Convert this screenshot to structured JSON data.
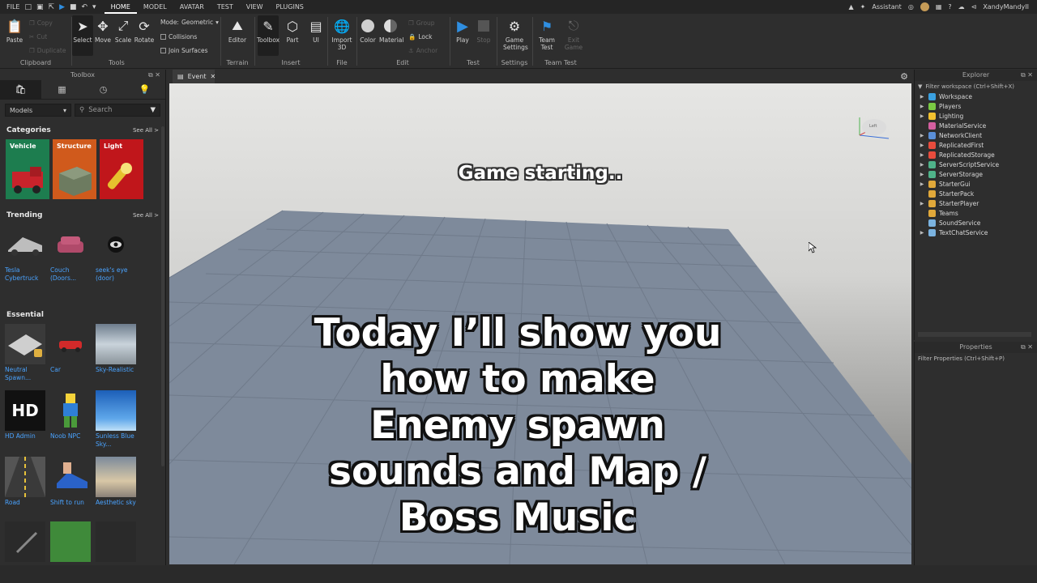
{
  "menubar": {
    "file": "FILE",
    "tabs": [
      "HOME",
      "MODEL",
      "AVATAR",
      "TEST",
      "VIEW",
      "PLUGINS"
    ],
    "active_tab": "HOME",
    "assistant": "Assistant",
    "username": "XandyMandyII"
  },
  "ribbon": {
    "clipboard": {
      "label": "Clipboard",
      "paste": "Paste",
      "copy": "Copy",
      "cut": "Cut",
      "duplicate": "Duplicate"
    },
    "tools": {
      "label": "Tools",
      "select": "Select",
      "move": "Move",
      "scale": "Scale",
      "rotate": "Rotate",
      "mode_label": "Mode:",
      "mode_value": "Geometric",
      "collisions": "Collisions",
      "join_surfaces": "Join Surfaces"
    },
    "terrain": {
      "label": "Terrain",
      "editor": "Editor"
    },
    "insert": {
      "label": "Insert",
      "toolbox": "Toolbox",
      "part": "Part",
      "ui": "UI"
    },
    "file": {
      "label": "File",
      "import": "Import\n3D"
    },
    "edit": {
      "label": "Edit",
      "color": "Color",
      "material": "Material",
      "group": "Group",
      "lock": "Lock",
      "anchor": "Anchor"
    },
    "test": {
      "label": "Test",
      "play": "Play",
      "stop": "Stop"
    },
    "settings": {
      "label": "Settings",
      "game_settings": "Game\nSettings"
    },
    "team_test": {
      "label": "Team Test",
      "team_test": "Team\nTest",
      "exit_game": "Exit\nGame"
    }
  },
  "toolbox": {
    "title": "Toolbox",
    "category_value": "Models",
    "search_placeholder": "Search",
    "categories_heading": "Categories",
    "see_all": "See All >",
    "categories": [
      {
        "name": "Vehicle",
        "color": "#1d7d4f"
      },
      {
        "name": "Structure",
        "color": "#d05a1c"
      },
      {
        "name": "Light",
        "color": "#c0161b"
      }
    ],
    "trending_heading": "Trending",
    "trending": [
      {
        "name": "Tesla Cybertruck"
      },
      {
        "name": "Couch (Doors..."
      },
      {
        "name": "seek's eye (door)"
      }
    ],
    "essential_heading": "Essential",
    "essential": [
      {
        "name": "Neutral Spawn..."
      },
      {
        "name": "Car"
      },
      {
        "name": "Sky-Realistic"
      },
      {
        "name": "HD Admin"
      },
      {
        "name": "Noob NPC"
      },
      {
        "name": "Sunless Blue Sky..."
      },
      {
        "name": "Road"
      },
      {
        "name": "Shift to run"
      },
      {
        "name": "Aesthetic sky"
      }
    ]
  },
  "document_tab": {
    "label": "Event"
  },
  "viewport": {
    "status_text": "Game starting..",
    "caption_lines": [
      "Today I’ll show you",
      "how to make",
      "Enemy spawn",
      "sounds and Map /",
      "Boss Music"
    ],
    "viewcube_label": "Left"
  },
  "explorer": {
    "title": "Explorer",
    "filter": "Filter workspace (Ctrl+Shift+X)",
    "items": [
      {
        "name": "Workspace",
        "expandable": true,
        "color": "#3aa0e0"
      },
      {
        "name": "Players",
        "expandable": true,
        "color": "#7ac943"
      },
      {
        "name": "Lighting",
        "expandable": true,
        "color": "#f2c230"
      },
      {
        "name": "MaterialService",
        "expandable": false,
        "color": "#d45fa0"
      },
      {
        "name": "NetworkClient",
        "expandable": true,
        "color": "#5a8fd8"
      },
      {
        "name": "ReplicatedFirst",
        "expandable": true,
        "color": "#e84c3d"
      },
      {
        "name": "ReplicatedStorage",
        "expandable": true,
        "color": "#e84c3d"
      },
      {
        "name": "ServerScriptService",
        "expandable": true,
        "color": "#4fb38a"
      },
      {
        "name": "ServerStorage",
        "expandable": true,
        "color": "#4fb38a"
      },
      {
        "name": "StarterGui",
        "expandable": true,
        "color": "#e0a83a"
      },
      {
        "name": "StarterPack",
        "expandable": false,
        "color": "#e0a83a"
      },
      {
        "name": "StarterPlayer",
        "expandable": true,
        "color": "#e0a83a"
      },
      {
        "name": "Teams",
        "expandable": false,
        "color": "#e0a83a"
      },
      {
        "name": "SoundService",
        "expandable": false,
        "color": "#7bb3e0"
      },
      {
        "name": "TextChatService",
        "expandable": true,
        "color": "#7bb3e0"
      }
    ]
  },
  "properties": {
    "title": "Properties",
    "filter": "Filter Properties (Ctrl+Shift+P)"
  }
}
